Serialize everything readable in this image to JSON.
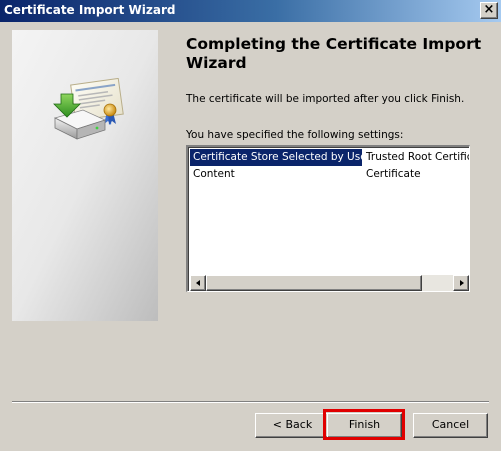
{
  "window": {
    "title": "Certificate Import Wizard",
    "close_glyph": "×"
  },
  "page": {
    "heading": "Completing the Certificate Import Wizard",
    "intro": "The certificate will be imported after you click Finish.",
    "settings_label": "You have specified the following settings:"
  },
  "settings_list": {
    "rows": [
      {
        "name": "Certificate Store Selected by User",
        "value": "Trusted Root Certifica",
        "selected": true
      },
      {
        "name": "Content",
        "value": "Certificate",
        "selected": false
      }
    ]
  },
  "buttons": {
    "back": "< Back",
    "finish": "Finish",
    "cancel": "Cancel"
  },
  "colors": {
    "title_bar": "#0a246a",
    "selection": "#0a246a",
    "highlight_box": "#e00000",
    "dialog": "#d4d0c8"
  },
  "icons": [
    "close-icon",
    "certificate-import-wizard-icon",
    "scroll-left-arrow-icon",
    "scroll-right-arrow-icon"
  ]
}
